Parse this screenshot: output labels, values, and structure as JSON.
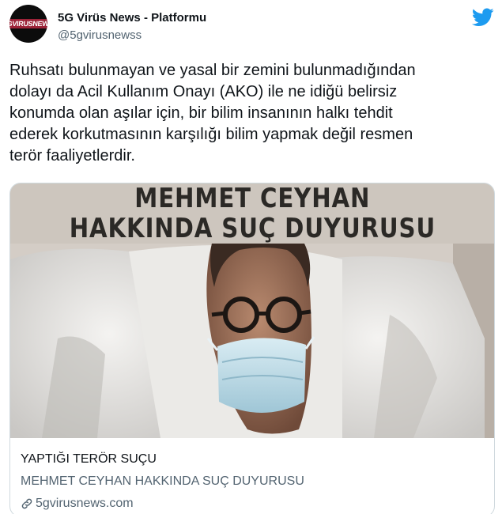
{
  "account": {
    "display_name": "5G Virüs News - Platformu",
    "handle": "@5gvirusnewss",
    "avatar_text": "5GVIRUSNEWS"
  },
  "icons": {
    "brand": "twitter-bird-icon",
    "link": "link-icon"
  },
  "tweet": {
    "lines": [
      "Ruhsatı bulunmayan ve  yasal bir zemini bulunmadığından",
      "dolayı da Acil Kullanım Onayı (AKO) ile ne idiğü belirsiz",
      "konumda olan aşılar için, bir bilim insanının halkı tehdit",
      "ederek korkutmasının karşılığı bilim yapmak değil resmen",
      "terör faaliyetlerdir."
    ]
  },
  "card": {
    "banner_line1": "MEHMET CEYHAN",
    "banner_line2": "HAKKINDA SUÇ DUYURUSU",
    "title": "YAPTIĞI TERÖR SUÇU",
    "description": "MEHMET CEYHAN HAKKINDA SUÇ DUYURUSU",
    "domain": "5gvirusnews.com"
  },
  "colors": {
    "twitter_blue": "#1d9bf0",
    "secondary_text": "#536471",
    "card_border": "#cfd9de"
  }
}
